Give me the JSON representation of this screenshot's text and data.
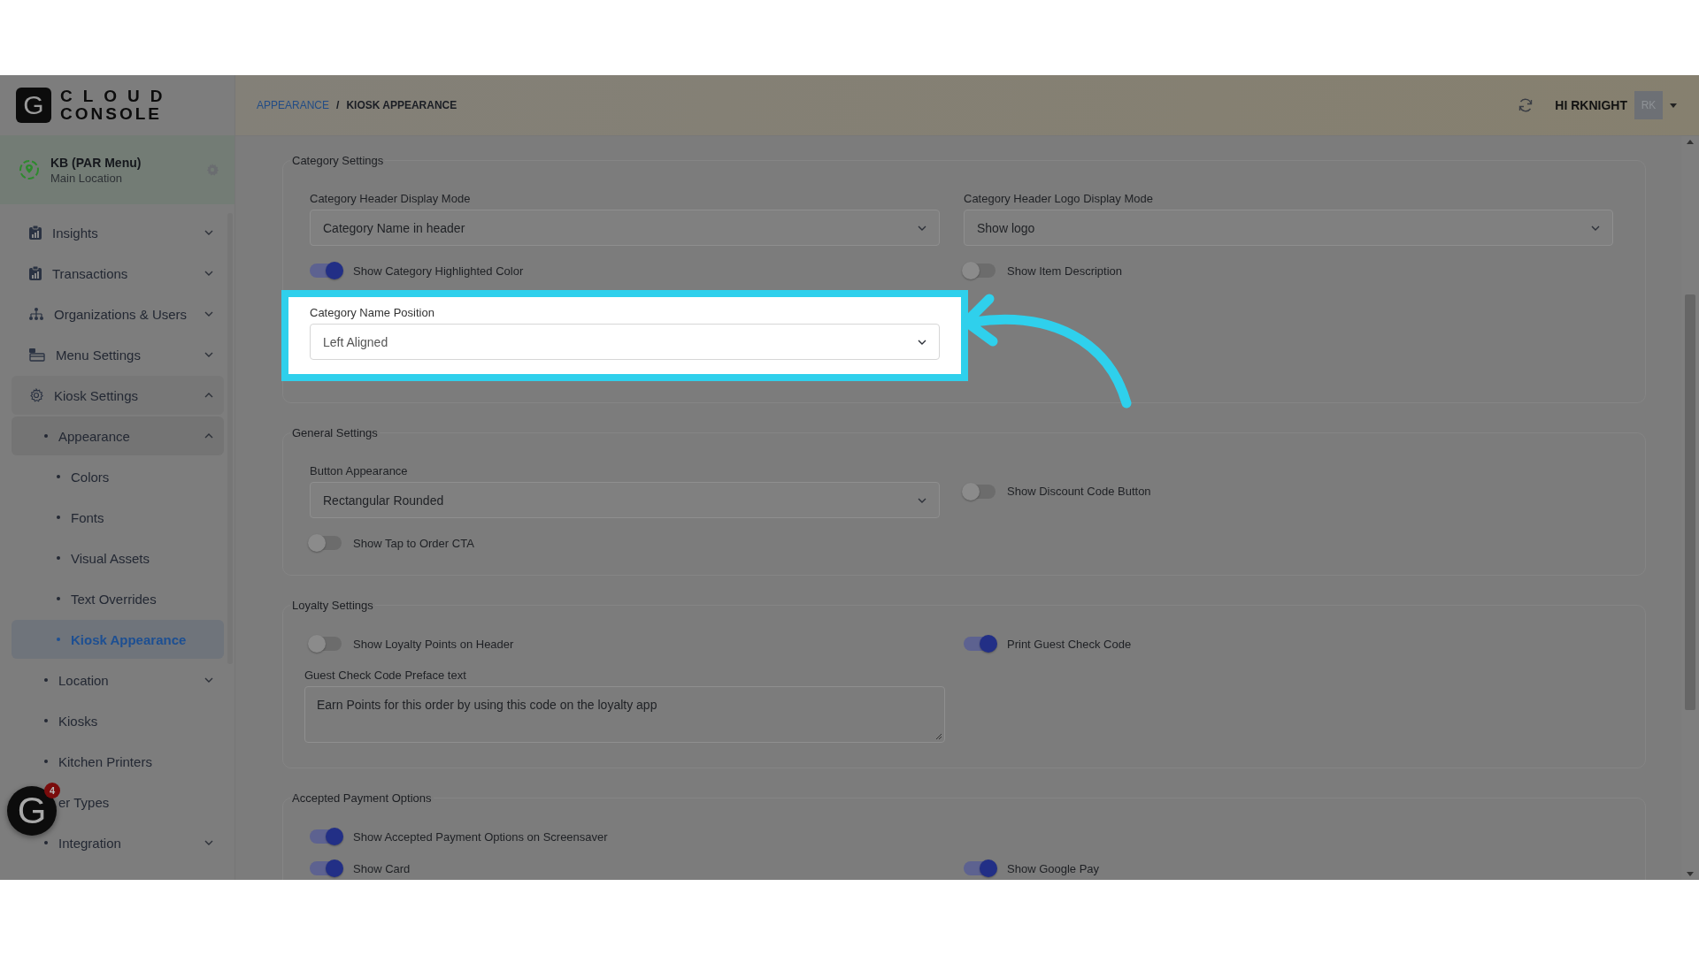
{
  "brand": {
    "logo_letter": "G",
    "line1": "CLOUD",
    "line2": "CONSOLE"
  },
  "location": {
    "name": "KB (PAR Menu)",
    "subtitle": "Main Location"
  },
  "sidebar": {
    "items": [
      {
        "label": "Insights",
        "kind": "group",
        "expanded": false,
        "selected": false
      },
      {
        "label": "Transactions",
        "kind": "group",
        "expanded": false,
        "selected": false
      },
      {
        "label": "Organizations & Users",
        "kind": "group",
        "expanded": false,
        "selected": false
      },
      {
        "label": "Menu Settings",
        "kind": "group",
        "expanded": false,
        "selected": false
      },
      {
        "label": "Kiosk Settings",
        "kind": "group",
        "expanded": true,
        "selected": false,
        "children": [
          {
            "label": "Appearance",
            "kind": "group",
            "expanded": true,
            "selected": false,
            "children": [
              {
                "label": "Colors",
                "kind": "link",
                "selected": false
              },
              {
                "label": "Fonts",
                "kind": "link",
                "selected": false
              },
              {
                "label": "Visual Assets",
                "kind": "link",
                "selected": false
              },
              {
                "label": "Text Overrides",
                "kind": "link",
                "selected": false
              },
              {
                "label": "Kiosk Appearance",
                "kind": "link",
                "selected": true
              }
            ]
          },
          {
            "label": "Location",
            "kind": "group",
            "expanded": false,
            "selected": false
          },
          {
            "label": "Kiosks",
            "kind": "link",
            "selected": false
          },
          {
            "label": "Kitchen Printers",
            "kind": "link",
            "selected": false
          },
          {
            "label": "er Types",
            "kind": "link",
            "selected": false
          },
          {
            "label": "Integration",
            "kind": "group",
            "expanded": false,
            "selected": false
          }
        ]
      }
    ]
  },
  "help_widget": {
    "letter": "G",
    "badge": "4"
  },
  "breadcrumb": {
    "items": [
      "APPEARANCE",
      "KIOSK APPEARANCE"
    ],
    "separator": "/"
  },
  "user": {
    "greeting": "HI RKNIGHT",
    "initials": "RK"
  },
  "sections": [
    {
      "title": "Category Settings",
      "rows": [
        [
          {
            "kind": "select",
            "label": "Category Header Display Mode",
            "value": "Category Name in header"
          },
          {
            "kind": "select",
            "label": "Category Header Logo Display Mode",
            "value": "Show logo"
          }
        ],
        [
          {
            "kind": "toggle",
            "label": "Show Category Highlighted Color",
            "on": true
          },
          {
            "kind": "toggle",
            "label": "Show Item Description",
            "on": false
          }
        ],
        [
          {
            "kind": "select",
            "label": "Category Name Position",
            "value": "Left Aligned",
            "highlighted": true
          }
        ]
      ]
    },
    {
      "title": "General Settings",
      "rows": [
        [
          {
            "kind": "select",
            "label": "Button Appearance",
            "value": "Rectangular Rounded"
          },
          {
            "kind": "toggle",
            "label": "Show Discount Code Button",
            "on": false
          }
        ],
        [
          {
            "kind": "toggle",
            "label": "Show Tap to Order CTA",
            "on": false
          }
        ]
      ]
    },
    {
      "title": "Loyalty Settings",
      "rows": [
        [
          {
            "kind": "toggle",
            "label": "Show Loyalty Points on Header",
            "on": false
          },
          {
            "kind": "toggle",
            "label": "Print Guest Check Code",
            "on": true
          }
        ],
        [
          {
            "kind": "textarea",
            "label": "Guest Check Code Preface text",
            "value": "Earn Points for this order by using this code on the loyalty app"
          }
        ]
      ]
    },
    {
      "title": "Accepted Payment Options",
      "rows": [
        [
          {
            "kind": "toggle",
            "label": "Show Accepted Payment Options on Screensaver",
            "on": true
          }
        ],
        [
          {
            "kind": "toggle",
            "label": "Show Card",
            "on": true
          },
          {
            "kind": "toggle",
            "label": "Show Google Pay",
            "on": true
          }
        ]
      ]
    }
  ]
}
